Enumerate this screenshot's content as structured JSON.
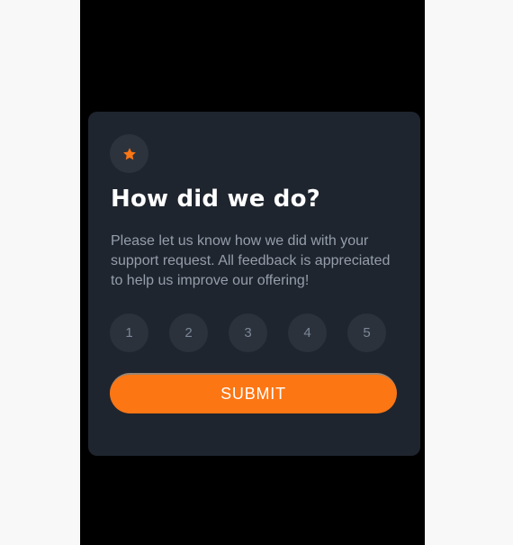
{
  "colors": {
    "background": "#f8f8f8",
    "viewport": "#000000",
    "card": "#1f252e",
    "accent": "#fc7614",
    "rating_bg": "#2b323c",
    "muted_text": "#959eac"
  },
  "card": {
    "icon": "star-icon",
    "title": "How did we do?",
    "description": "Please let us know how we did with your support request. All feedback is appreciated to help us improve our offering!",
    "ratings": [
      "1",
      "2",
      "3",
      "4",
      "5"
    ],
    "submit_label": "SUBMIT"
  }
}
